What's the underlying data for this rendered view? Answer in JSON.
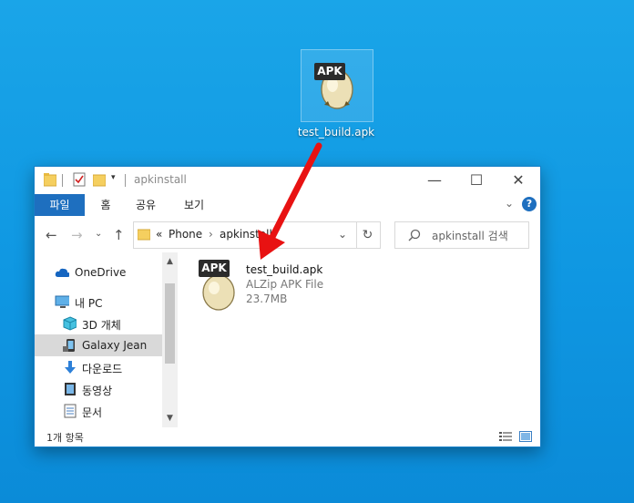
{
  "desktop": {
    "icon_badge": "APK",
    "icon_label": "test_build.apk"
  },
  "window": {
    "title": "apkinstall",
    "ribbon_tabs": [
      "파일",
      "홈",
      "공유",
      "보기"
    ],
    "breadcrumb_sep": "«",
    "breadcrumb": [
      "Phone",
      "apkinstall"
    ],
    "search_placeholder": "apkinstall 검색",
    "sidebar": [
      {
        "label": "OneDrive",
        "icon": "cloud-icon"
      },
      {
        "label": "내 PC",
        "icon": "computer-icon"
      },
      {
        "label": "3D 개체",
        "icon": "cube-icon"
      },
      {
        "label": "Galaxy Jean",
        "icon": "phone-icon"
      },
      {
        "label": "다운로드",
        "icon": "download-icon"
      },
      {
        "label": "동영상",
        "icon": "video-icon"
      },
      {
        "label": "문서",
        "icon": "document-icon"
      }
    ],
    "file": {
      "badge": "APK",
      "name": "test_build.apk",
      "type": "ALZip APK File",
      "size": "23.7MB"
    },
    "status": "1개 항목"
  },
  "colors": {
    "desktop_bg": "#1aa5e8",
    "accent": "#1e6fbf",
    "arrow": "#e81212"
  }
}
